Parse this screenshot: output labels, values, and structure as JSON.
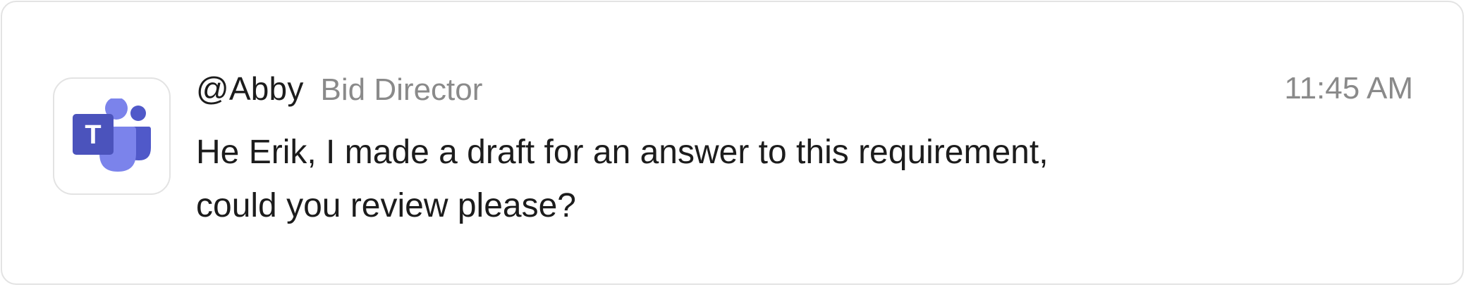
{
  "app": {
    "icon": "microsoft-teams-icon",
    "icon_letter": "T",
    "colors": {
      "teams_dark": "#4b53bc",
      "teams_mid": "#5059c9",
      "teams_light": "#7b83eb"
    }
  },
  "message": {
    "sender": "@Abby",
    "role": "Bid Director",
    "time": "11:45 AM",
    "lines": [
      "He Erik, I made a draft for an answer to this requirement,",
      "could you review please?"
    ]
  }
}
